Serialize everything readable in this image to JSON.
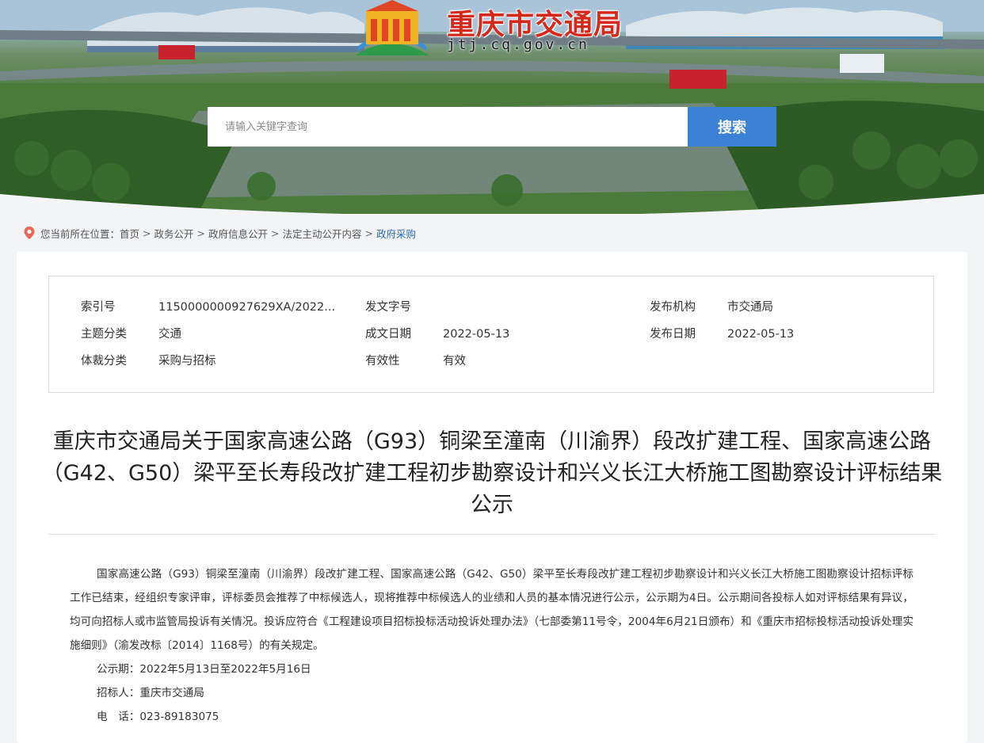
{
  "header": {
    "site_name": "重庆市交通局",
    "site_url": "jtj.cq.gov.cn",
    "search_placeholder": "请输入关键字查询",
    "search_button": "搜索"
  },
  "breadcrumb": {
    "prefix": "您当前所在位置：",
    "items": [
      "首页",
      "政务公开",
      "政府信息公开",
      "法定主动公开内容"
    ],
    "current": "政府采购",
    "separator": ">"
  },
  "meta": {
    "index_no_label": "索引号",
    "index_no": "1150000000927629XA/2022...",
    "doc_no_label": "发文字号",
    "doc_no": "",
    "issuer_label": "发布机构",
    "issuer": "市交通局",
    "topic_label": "主题分类",
    "topic": "交通",
    "written_date_label": "成文日期",
    "written_date": "2022-05-13",
    "publish_date_label": "发布日期",
    "publish_date": "2022-05-13",
    "genre_label": "体裁分类",
    "genre": "采购与招标",
    "validity_label": "有效性",
    "validity": "有效"
  },
  "document": {
    "title": "重庆市交通局关于国家高速公路（G93）铜梁至潼南（川渝界）段改扩建工程、国家高速公路（G42、G50）梁平至长寿段改扩建工程初步勘察设计和兴义长江大桥施工图勘察设计评标结果公示",
    "paragraph": "国家高速公路（G93）铜梁至潼南（川渝界）段改扩建工程、国家高速公路（G42、G50）梁平至长寿段改扩建工程初步勘察设计和兴义长江大桥施工图勘察设计招标评标工作已结束，经组织专家评审，评标委员会推荐了中标候选人，现将推荐中标候选人的业绩和人员的基本情况进行公示，公示期为4日。公示期间各投标人如对评标结果有异议，均可向招标人或市监管局投诉有关情况。投诉应符合《工程建设项目招标投标活动投诉处理办法》（七部委第11号令，2004年6月21日颁布）和《重庆市招标投标活动投诉处理实施细则》（渝发改标〔2014〕1168号）的有关规定。",
    "period": "公示期：2022年5月13日至2022年5月16日",
    "tenderer": "招标人：重庆市交通局",
    "phone": "电　话：023-89183075"
  },
  "colors": {
    "accent": "#3b82d6",
    "site_name": "#d42a1e",
    "breadcrumb_current": "#2f6db5"
  }
}
